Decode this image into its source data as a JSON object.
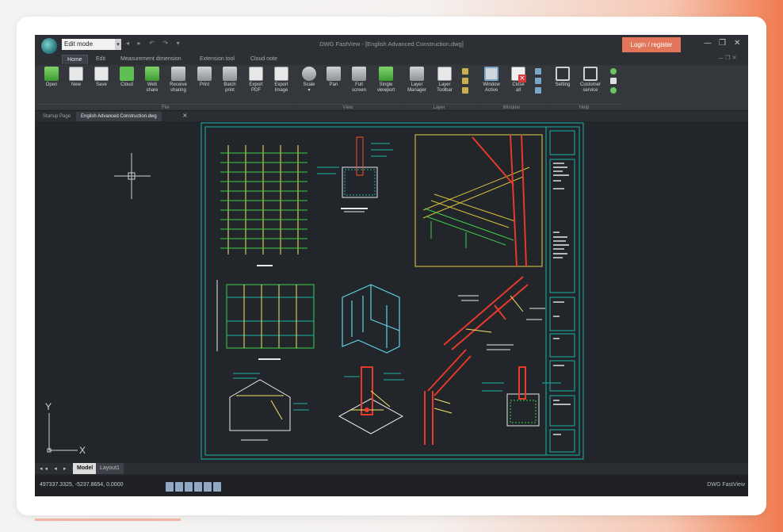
{
  "app": {
    "title": "DWG FastView - [English Advanced Construction.dwg]",
    "mode_select": "Edit mode",
    "login_label": "Login / register",
    "window_controls": [
      "—",
      "❐",
      "✕"
    ],
    "mini_controls": "— ❐ ✕"
  },
  "menu": {
    "tabs": [
      {
        "label": "Home"
      },
      {
        "label": "Edit"
      },
      {
        "label": "Measurement dimension"
      },
      {
        "label": "Extension tool"
      },
      {
        "label": "Cloud note"
      }
    ]
  },
  "ribbon": {
    "buttons": [
      {
        "label": "Open",
        "icon": "folder-open-icon"
      },
      {
        "label": "New",
        "icon": "new-file-icon"
      },
      {
        "label": "Save",
        "icon": "save-icon"
      },
      {
        "label": "Cloud",
        "icon": "cloud-icon"
      },
      {
        "label": "Web\nshare",
        "icon": "web-share-icon"
      },
      {
        "label": "Receive\nsharing",
        "icon": "receive-sharing-icon"
      },
      {
        "label": "Print",
        "icon": "print-icon"
      },
      {
        "label": "Batch\nprint",
        "icon": "batch-print-icon"
      },
      {
        "label": "Export\nPDF",
        "icon": "export-pdf-icon"
      },
      {
        "label": "Export\nImage",
        "icon": "export-image-icon"
      },
      {
        "label": "Scale\n▾",
        "icon": "scale-icon"
      },
      {
        "label": "Pan",
        "icon": "pan-hand-icon"
      },
      {
        "label": "Full\nscreen",
        "icon": "full-screen-icon"
      },
      {
        "label": "Single\nviewport",
        "icon": "single-viewport-icon"
      },
      {
        "label": "Layer\nManager",
        "icon": "layer-manager-icon"
      },
      {
        "label": "Layer\nToolbar",
        "icon": "layer-toolbar-icon"
      },
      {
        "label": "Window\nActive",
        "icon": "window-active-icon"
      },
      {
        "label": "Close\nall",
        "icon": "close-all-icon"
      },
      {
        "label": "Setting",
        "icon": "setting-gear-icon"
      },
      {
        "label": "Customer\nservice",
        "icon": "customer-service-icon"
      }
    ],
    "groups": [
      {
        "label": "File"
      },
      {
        "label": "View"
      },
      {
        "label": "Layer"
      },
      {
        "label": "Window"
      },
      {
        "label": "Help"
      }
    ]
  },
  "documents": {
    "tabs": [
      {
        "label": "Startup Page"
      },
      {
        "label": "English Advanced Construction.dwg"
      }
    ]
  },
  "layout_tabs": [
    {
      "label": "Model"
    },
    {
      "label": "Layout1"
    }
  ],
  "layout_nav": "◂◂ ◂ ▸ ▸▸",
  "axes": {
    "x": "X",
    "y": "Y"
  },
  "status": {
    "coordinates": "497337.3325, -5237.8654, 0.0000",
    "brand": "DWG FastView"
  },
  "colors": {
    "canvas": "#22252a",
    "frame": "#19b3a4",
    "accent": "#e3765a"
  }
}
